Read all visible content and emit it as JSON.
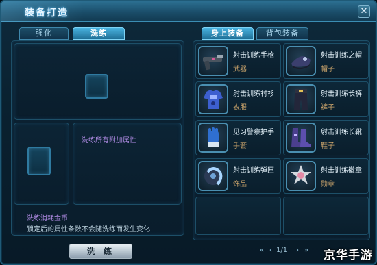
{
  "window": {
    "title": "装备打造"
  },
  "left_tabs": [
    {
      "label": "强化",
      "active": false
    },
    {
      "label": "洗练",
      "active": true
    }
  ],
  "right_tabs": [
    {
      "label": "身上装备",
      "active": true
    },
    {
      "label": "背包装备",
      "active": false
    }
  ],
  "wash_panel": {
    "attr_text": "洗练所有附加属性",
    "cost_label": "洗练消耗金币",
    "lock_note": "锁定后的属性条数不会随洗练而发生变化",
    "wash_button": "洗 练"
  },
  "equipment": [
    {
      "name": "射击训练手枪",
      "type": "武器",
      "icon": "pistol-icon"
    },
    {
      "name": "射击训练之帽",
      "type": "帽子",
      "icon": "hat-icon"
    },
    {
      "name": "射击训练衬衫",
      "type": "衣服",
      "icon": "shirt-icon"
    },
    {
      "name": "射击训练长裤",
      "type": "裤子",
      "icon": "pants-icon"
    },
    {
      "name": "见习警察护手",
      "type": "手套",
      "icon": "glove-icon"
    },
    {
      "name": "射击训练长靴",
      "type": "鞋子",
      "icon": "boots-icon"
    },
    {
      "name": "射击训练弹匣",
      "type": "饰品",
      "icon": "magazine-icon"
    },
    {
      "name": "射击训练徽章",
      "type": "勋章",
      "icon": "badge-icon"
    }
  ],
  "pager": {
    "text": "1/1"
  },
  "watermark": "京华手游",
  "colors": {
    "accent": "#49b3e0",
    "item_type": "#c9a36b",
    "attr_text": "#b48ee8"
  }
}
